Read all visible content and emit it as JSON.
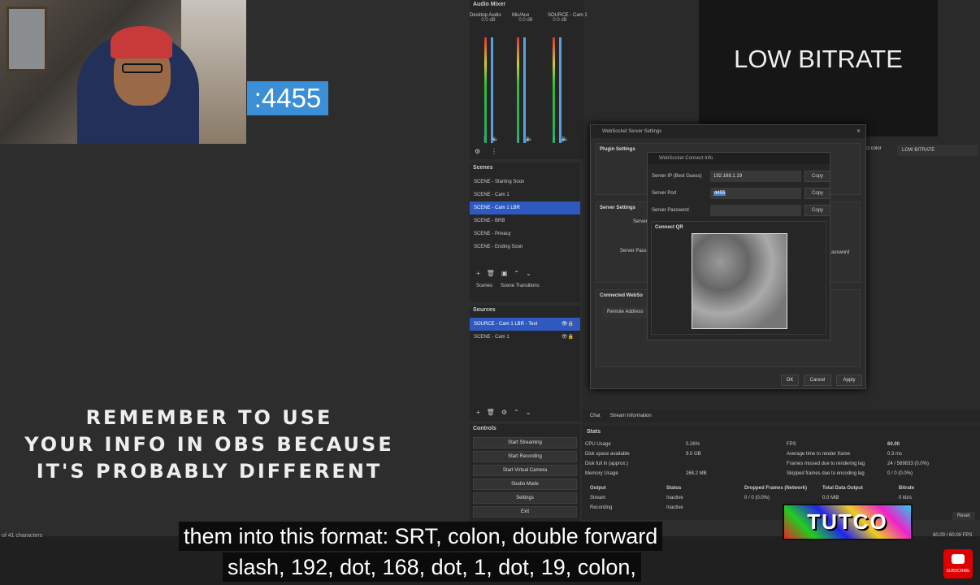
{
  "webcam": {
    "port_tag": ":4455"
  },
  "overlay_note": {
    "line1": "REMEMBER TO USE",
    "line2": "YOUR INFO IN OBS BECAUSE",
    "line3": "IT'S PROBABLY DIFFERENT"
  },
  "char_count": "of 41 characters",
  "audio_mixer": {
    "title": "Audio Mixer",
    "channels": [
      {
        "name": "Desktop Audio",
        "db": "0.0 dB"
      },
      {
        "name": "Mic/Aux",
        "db": "0.0 dB"
      },
      {
        "name": "SOURCE - Cam 1",
        "db": "0.0 dB"
      }
    ]
  },
  "scenes": {
    "title": "Scenes",
    "items": [
      "SCENE - Starting Soon",
      "SCENE - Cam 1",
      "SCENE - Cam 1 LBR",
      "SCENE - BRB",
      "SCENE - Privacy",
      "SCENE - Ending Soon"
    ],
    "tab_scenes": "Scenes",
    "tab_transitions": "Scene Transitions"
  },
  "sources": {
    "title": "Sources",
    "items": [
      "SOURCE - Cam 1 LBR - Text",
      "SCENE - Cam 1"
    ]
  },
  "controls": {
    "title": "Controls",
    "buttons": [
      "Start Streaming",
      "Start Recording",
      "Start Virtual Camera",
      "Studio Mode",
      "Settings",
      "Exit"
    ]
  },
  "preview": {
    "text": "LOW BITRATE",
    "source_label": "LOW BITRATE",
    "select_color": "ect color"
  },
  "ws_dialog": {
    "title": "WebSocket Server Settings",
    "plugin_settings": "Plugin Settings",
    "server_settings": "Server Settings",
    "connected": "Connected WebSo",
    "remote_address": "Remote Address",
    "server_frag": "Server",
    "server_pass_frag": "Server Pass",
    "password_frag": "assword",
    "ok": "OK",
    "cancel": "Cancel",
    "apply": "Apply"
  },
  "connect_info": {
    "title": "WebSocket Connect Info",
    "ip_label": "Server IP (Best Guess)",
    "ip_value": "192.168.1.19",
    "port_label": "Server Port",
    "port_value": "4455",
    "pass_label": "Server Password",
    "pass_value": "",
    "copy": "Copy",
    "qr_label": "Connect QR"
  },
  "bottom_tabs": {
    "chat": "Chat",
    "stream_info": "Stream Information"
  },
  "stats": {
    "title": "Stats",
    "rows": [
      {
        "k": "CPU Usage",
        "v": "0.26%"
      },
      {
        "k": "Disk space available",
        "v": "9.0 GB"
      },
      {
        "k": "Disk full in (approx.)",
        "v": ""
      },
      {
        "k": "Memory Usage",
        "v": "268.2 MB"
      }
    ],
    "rows_right": [
      {
        "k": "FPS",
        "v": "60.00"
      },
      {
        "k": "Average time to render frame",
        "v": "0.3 ms"
      },
      {
        "k": "Frames missed due to rendering lag",
        "v": "24 / 569833 (0.0%)"
      },
      {
        "k": "Skipped frames due to encoding lag",
        "v": "0 / 0 (0.0%)"
      }
    ],
    "out_headers": [
      "Output",
      "Status",
      "Dropped Frames (Network)",
      "Total Data Output",
      "Bitrate"
    ],
    "out_rows": [
      [
        "Stream",
        "Inactive",
        "0 / 0 (0.0%)",
        "0.0 MiB",
        "0 kb/s"
      ],
      [
        "Recording",
        "Inactive",
        "",
        "",
        ""
      ]
    ],
    "reset": "Reset",
    "fps_footer": "60.00 / 60.00 FPS"
  },
  "captions": {
    "line1": "them into this format: SRT, colon, double forward",
    "line2": "slash, 192, dot, 168, dot, 1, dot, 19, colon,"
  },
  "logo": "TUTCO",
  "subscribe": "SUBSCRIBE"
}
